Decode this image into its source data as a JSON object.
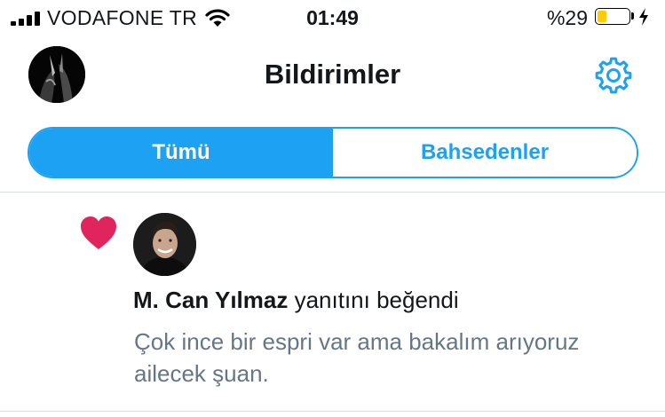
{
  "status_bar": {
    "carrier": "VODAFONE TR",
    "time": "01:49",
    "battery_percent": "%29",
    "battery_level": 0.29,
    "battery_color": "#ffcc00"
  },
  "header": {
    "title": "Bildirimler",
    "settings_icon": "gear-icon"
  },
  "tabs": [
    {
      "label": "Tümü",
      "active": true
    },
    {
      "label": "Bahsedenler",
      "active": false
    }
  ],
  "notifications": [
    {
      "type_icon": "heart-icon",
      "user_name": "M. Can Yılmaz",
      "action": " yanıtını beğendi",
      "quote": "Çok ince bir espri var ama bakalım arıyoruz ailecek şuan."
    }
  ],
  "colors": {
    "accent": "#1da1f2",
    "like": "#e0245e",
    "secondary_text": "#657786"
  }
}
